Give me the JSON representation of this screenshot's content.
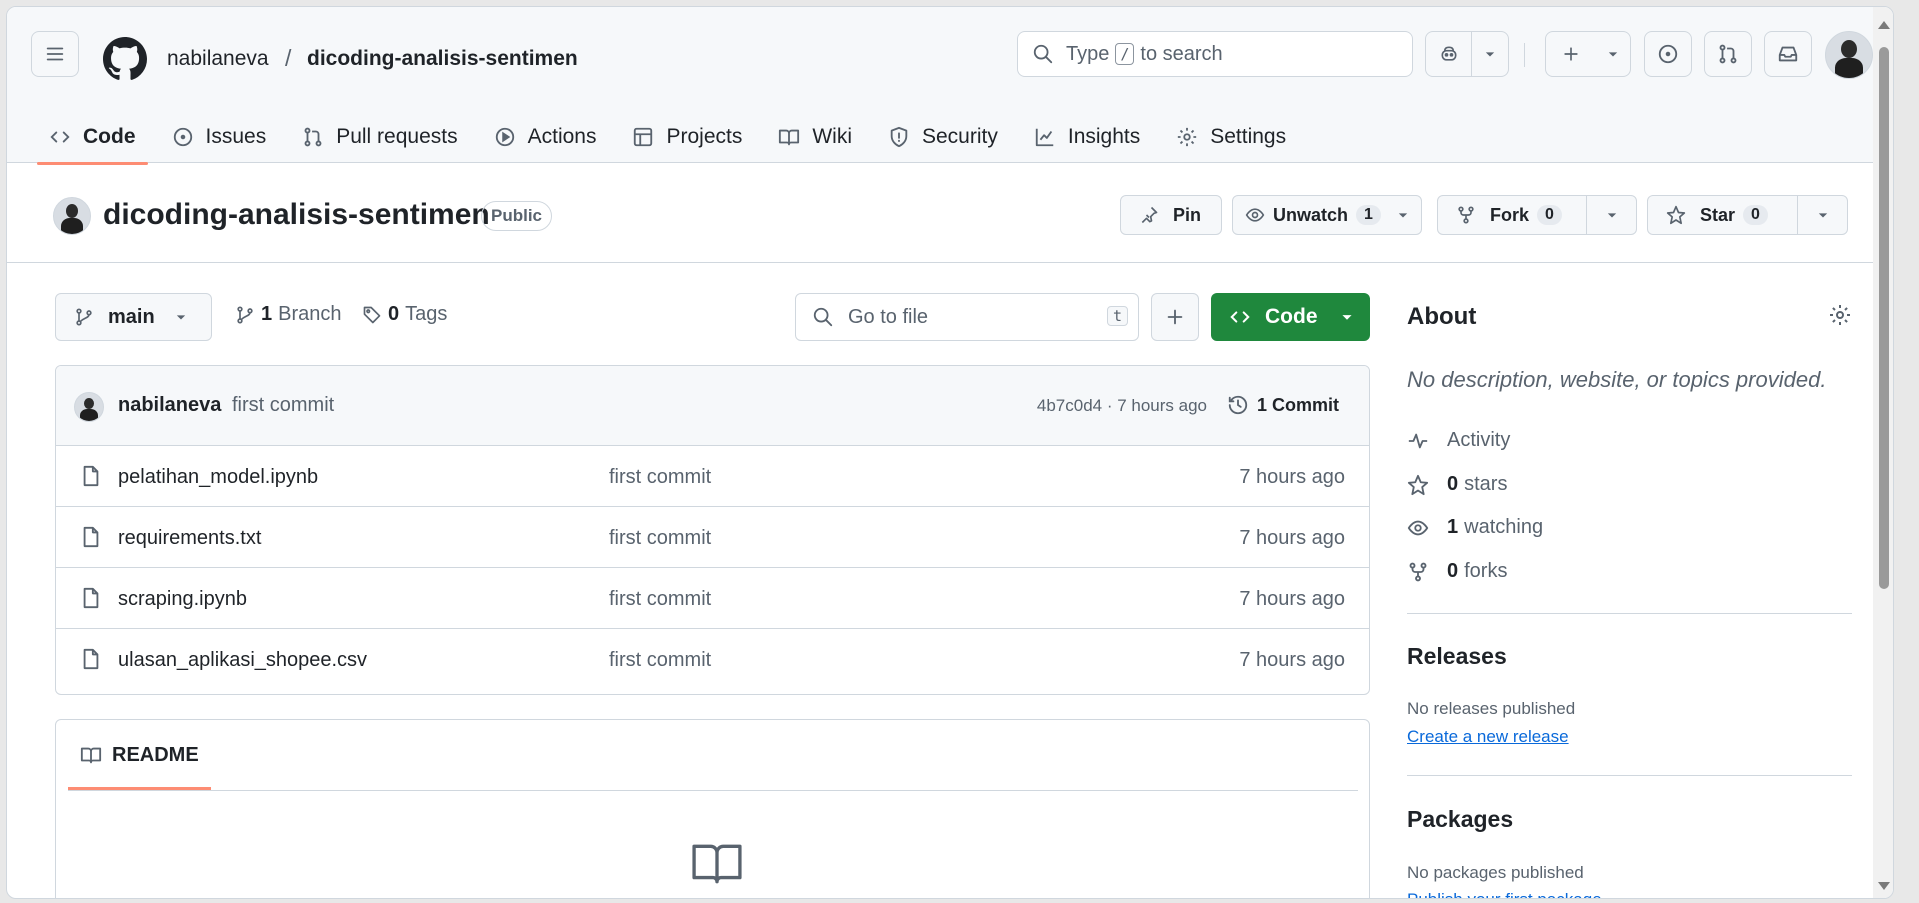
{
  "header": {
    "owner": "nabilaneva",
    "separator": "/",
    "repo": "dicoding-analisis-sentimen",
    "search": {
      "prefix": "Type",
      "key": "/",
      "suffix": "to search"
    }
  },
  "nav": {
    "tabs": [
      {
        "label": "Code",
        "icon": "code-icon",
        "active": true
      },
      {
        "label": "Issues",
        "icon": "issue-icon"
      },
      {
        "label": "Pull requests",
        "icon": "pull-request-icon"
      },
      {
        "label": "Actions",
        "icon": "play-icon"
      },
      {
        "label": "Projects",
        "icon": "table-icon"
      },
      {
        "label": "Wiki",
        "icon": "book-icon"
      },
      {
        "label": "Security",
        "icon": "shield-icon"
      },
      {
        "label": "Insights",
        "icon": "graph-icon"
      },
      {
        "label": "Settings",
        "icon": "gear-icon"
      }
    ]
  },
  "repo": {
    "name": "dicoding-analisis-sentimen",
    "visibility": "Public",
    "pin_label": "Pin",
    "unwatch_label": "Unwatch",
    "watch_count": "1",
    "fork_label": "Fork",
    "fork_count": "0",
    "star_label": "Star",
    "star_count": "0"
  },
  "toolbar": {
    "branch": "main",
    "branch_count": "1",
    "branch_label": "Branch",
    "tag_count": "0",
    "tag_label": "Tags",
    "go_to_file": "Go to file",
    "go_to_file_key": "t",
    "code_label": "Code"
  },
  "commit": {
    "author": "nabilaneva",
    "message": "first commit",
    "sha_time": "4b7c0d4 · 7 hours ago",
    "count_label": "1 Commit"
  },
  "files": [
    {
      "name": "pelatihan_model.ipynb",
      "commit": "first commit",
      "age": "7 hours ago"
    },
    {
      "name": "requirements.txt",
      "commit": "first commit",
      "age": "7 hours ago"
    },
    {
      "name": "scraping.ipynb",
      "commit": "first commit",
      "age": "7 hours ago"
    },
    {
      "name": "ulasan_aplikasi_shopee.csv",
      "commit": "first commit",
      "age": "7 hours ago"
    }
  ],
  "readme": {
    "tab_label": "README"
  },
  "about": {
    "title": "About",
    "description": "No description, website, or topics provided.",
    "activity": "Activity",
    "stars_count": "0",
    "stars_label": "stars",
    "watching_count": "1",
    "watching_label": "watching",
    "forks_count": "0",
    "forks_label": "forks"
  },
  "releases": {
    "title": "Releases",
    "empty": "No releases published",
    "link": "Create a new release"
  },
  "packages": {
    "title": "Packages",
    "empty": "No packages published",
    "link": "Publish your first package"
  },
  "colors": {
    "accent_green": "#1f883d",
    "link_blue": "#0969da",
    "tab_underline": "#fd8c73"
  }
}
